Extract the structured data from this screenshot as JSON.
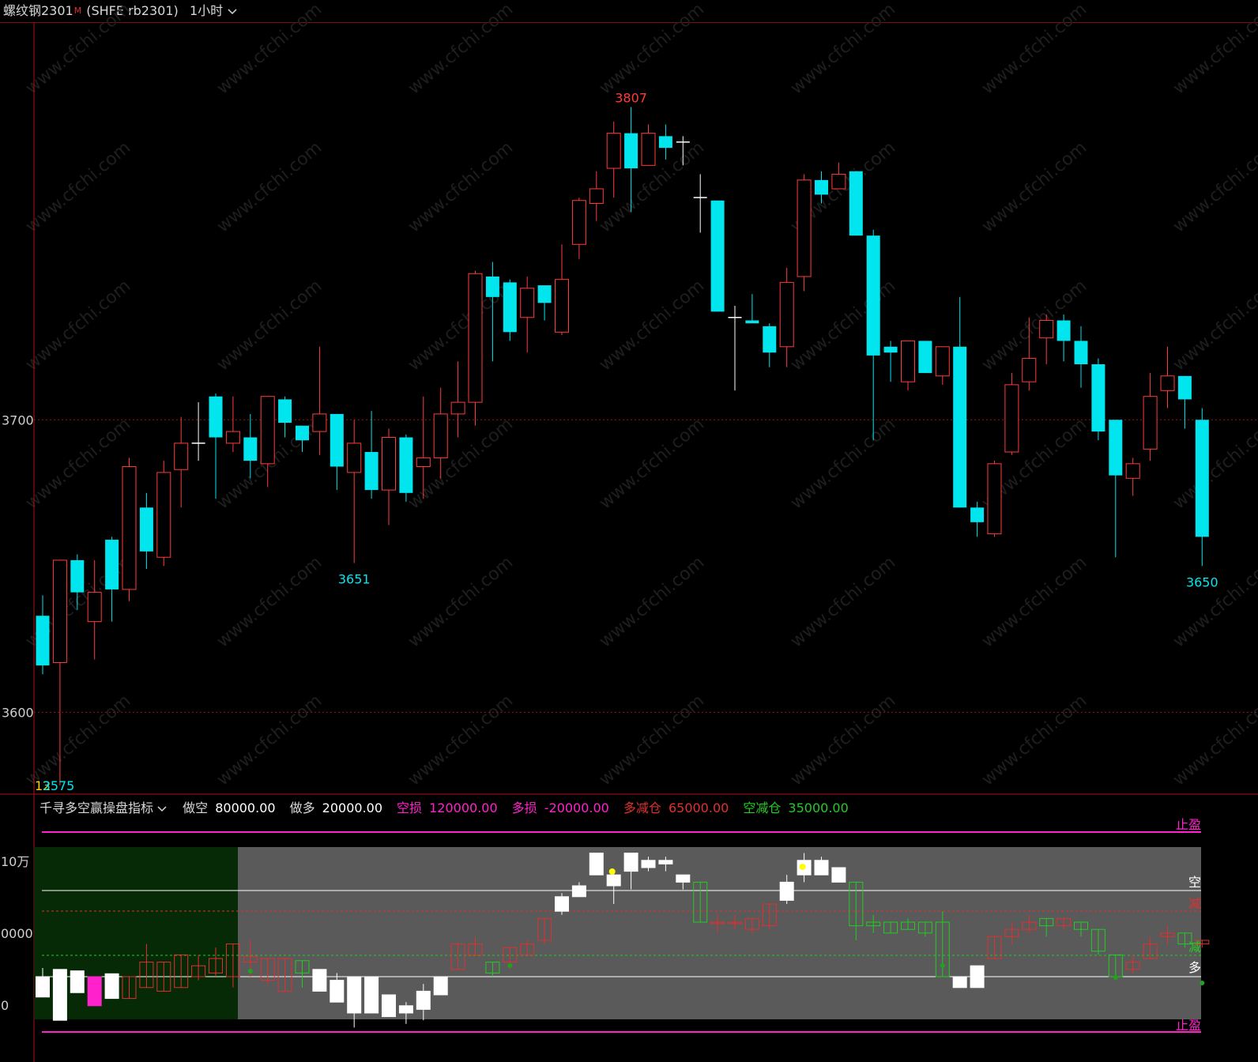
{
  "header": {
    "title": "螺纹钢2301",
    "superscript": "M",
    "code": "(SHFE rb2301)",
    "period": "1小时",
    "period_icon": "chevron-down-icon"
  },
  "indicator": {
    "name": "千寻多空赢操盘指标",
    "name_icon": "chevron-down-icon",
    "params": [
      {
        "label": "做空",
        "value": "80000.00",
        "label_color": "#d8d8d8",
        "value_color": "#ffffff"
      },
      {
        "label": "做多",
        "value": "20000.00",
        "label_color": "#d8d8d8",
        "value_color": "#ffffff"
      },
      {
        "label": "空损",
        "value": "120000.00",
        "label_color": "#ff22cc",
        "value_color": "#ff22cc"
      },
      {
        "label": "多损",
        "value": "-20000.00",
        "label_color": "#ff22cc",
        "value_color": "#ff22cc"
      },
      {
        "label": "多减仓",
        "value": "65000.00",
        "label_color": "#e03030",
        "value_color": "#e03030"
      },
      {
        "label": "空减仓",
        "value": "35000.00",
        "label_color": "#22cc22",
        "value_color": "#22cc22"
      }
    ],
    "y_labels": [
      "10万",
      "0000",
      "0"
    ],
    "right_labels": {
      "stop_top": "止盈",
      "stop_bottom": "止盈",
      "short": "空",
      "reduce_short": "减",
      "reduce_long": "减",
      "long": "多"
    },
    "bars": [
      {
        "open": 0,
        "close": -28,
        "high": 12,
        "low": -28
      },
      {
        "open": 10,
        "close": -60,
        "high": 10,
        "low": -60
      },
      {
        "open": 8,
        "close": -22,
        "high": 8,
        "low": -22
      },
      {
        "open": 0,
        "close": -40,
        "high": 0,
        "low": -40
      },
      {
        "open": 4,
        "close": -30,
        "high": 4,
        "low": -30
      },
      {
        "open": -30,
        "close": 0,
        "high": 0,
        "low": -30
      },
      {
        "open": -15,
        "close": 20,
        "high": 45,
        "low": -15
      },
      {
        "open": -20,
        "close": 20,
        "high": 20,
        "low": -20
      },
      {
        "open": -15,
        "close": 30,
        "high": 30,
        "low": -15
      },
      {
        "open": 0,
        "close": 15,
        "high": 30,
        "low": -5
      },
      {
        "open": 5,
        "close": 25,
        "high": 40,
        "low": 0
      },
      {
        "open": 0,
        "close": 45,
        "high": 45,
        "low": -15
      },
      {
        "open": 20,
        "close": 28,
        "high": 50,
        "low": 0
      },
      {
        "open": -5,
        "close": 25,
        "high": 25,
        "low": -10
      },
      {
        "open": -20,
        "close": 25,
        "high": 25,
        "low": -20
      },
      {
        "open": 22,
        "close": 5,
        "high": 22,
        "low": -15
      },
      {
        "open": 10,
        "close": -20,
        "high": 10,
        "low": -20
      },
      {
        "open": -5,
        "close": -35,
        "high": 5,
        "low": -35
      },
      {
        "open": 0,
        "close": -50,
        "high": 0,
        "low": -70
      },
      {
        "open": 0,
        "close": -50,
        "high": 0,
        "low": -50
      },
      {
        "open": -25,
        "close": -55,
        "high": -25,
        "low": -55
      },
      {
        "open": -40,
        "close": -50,
        "high": -35,
        "low": -65
      },
      {
        "open": -45,
        "close": -20,
        "high": -10,
        "low": -60
      },
      {
        "open": 0,
        "close": -25,
        "high": 0,
        "low": -25
      },
      {
        "open": 10,
        "close": 45,
        "high": 45,
        "low": 10
      },
      {
        "open": 30,
        "close": 45,
        "high": 55,
        "low": 30
      },
      {
        "open": 20,
        "close": 5,
        "high": 20,
        "low": 0
      },
      {
        "open": 20,
        "close": 40,
        "high": 40,
        "low": 10
      },
      {
        "open": 30,
        "close": 45,
        "high": 50,
        "low": 30
      },
      {
        "open": 50,
        "close": 80,
        "high": 80,
        "low": 45
      },
      {
        "open": 90,
        "close": 110,
        "high": 115,
        "low": 85
      },
      {
        "open": 110,
        "close": 125,
        "high": 130,
        "low": 110
      },
      {
        "open": 140,
        "close": 170,
        "high": 170,
        "low": 140
      },
      {
        "open": 125,
        "close": 140,
        "high": 145,
        "low": 100
      },
      {
        "open": 145,
        "close": 170,
        "high": 170,
        "low": 120
      },
      {
        "open": 150,
        "close": 160,
        "high": 165,
        "low": 145
      },
      {
        "open": 155,
        "close": 160,
        "high": 165,
        "low": 145
      },
      {
        "open": 140,
        "close": 130,
        "high": 140,
        "low": 120
      },
      {
        "open": 130,
        "close": 75,
        "high": 130,
        "low": 75
      },
      {
        "open": 75,
        "close": 75,
        "high": 85,
        "low": 60
      },
      {
        "open": 75,
        "close": 75,
        "high": 85,
        "low": 65
      },
      {
        "open": 65,
        "close": 80,
        "high": 80,
        "low": 60
      },
      {
        "open": 70,
        "close": 100,
        "high": 100,
        "low": 65
      },
      {
        "open": 105,
        "close": 130,
        "high": 140,
        "low": 100
      },
      {
        "open": 140,
        "close": 160,
        "high": 170,
        "low": 130
      },
      {
        "open": 140,
        "close": 160,
        "high": 165,
        "low": 140
      },
      {
        "open": 150,
        "close": 130,
        "high": 150,
        "low": 130
      },
      {
        "open": 130,
        "close": 70,
        "high": 130,
        "low": 50
      },
      {
        "open": 75,
        "close": 70,
        "high": 85,
        "low": 60
      },
      {
        "open": 75,
        "close": 60,
        "high": 75,
        "low": 60
      },
      {
        "open": 75,
        "close": 65,
        "high": 80,
        "low": 65
      },
      {
        "open": 75,
        "close": 60,
        "high": 75,
        "low": 55
      },
      {
        "open": 75,
        "close": 0,
        "high": 90,
        "low": 0
      },
      {
        "open": 0,
        "close": -15,
        "high": 0,
        "low": -15
      },
      {
        "open": 15,
        "close": -15,
        "high": 15,
        "low": -15
      },
      {
        "open": 25,
        "close": 55,
        "high": 55,
        "low": 25
      },
      {
        "open": 55,
        "close": 65,
        "high": 75,
        "low": 45
      },
      {
        "open": 65,
        "close": 75,
        "high": 85,
        "low": 60
      },
      {
        "open": 80,
        "close": 70,
        "high": 80,
        "low": 55
      },
      {
        "open": 70,
        "close": 80,
        "high": 80,
        "low": 65
      },
      {
        "open": 75,
        "close": 65,
        "high": 75,
        "low": 55
      },
      {
        "open": 65,
        "close": 35,
        "high": 65,
        "low": 30
      },
      {
        "open": 30,
        "close": 0,
        "high": 30,
        "low": 0
      },
      {
        "open": 10,
        "close": 20,
        "high": 30,
        "low": 5
      },
      {
        "open": 25,
        "close": 45,
        "high": 55,
        "low": 25
      },
      {
        "open": 55,
        "close": 60,
        "high": 70,
        "low": 45
      },
      {
        "open": 60,
        "close": 45,
        "high": 60,
        "low": 40
      },
      {
        "open": 45,
        "close": 50,
        "high": 50,
        "low": 40
      }
    ]
  },
  "chart_data": [
    {
      "type": "candlestick",
      "title": "螺纹钢2301 (SHFE rb2301) 1小时",
      "y_ticks": [
        3600,
        3700
      ],
      "ylim": [
        3572,
        3836
      ],
      "annotations": [
        {
          "text": "3807",
          "index": 34,
          "at": "high"
        },
        {
          "text": "3651",
          "index": 18,
          "at": "low"
        },
        {
          "text": "3650",
          "index": 67,
          "at": "low"
        },
        {
          "text": "12",
          "index": 1,
          "at": "bottom-left"
        },
        {
          "text": "3575",
          "index": 1,
          "at": "low"
        }
      ],
      "colors": {
        "up": "#ff3b3b",
        "down": "#00e5ee",
        "doji": "#ffffff",
        "grid": "#8b1a1a",
        "axis": "#b01010"
      },
      "candles": [
        {
          "o": 3633,
          "c": 3616,
          "h": 3640,
          "l": 3613
        },
        {
          "o": 3617,
          "c": 3652,
          "h": 3652,
          "l": 3575
        },
        {
          "o": 3652,
          "c": 3641,
          "h": 3654,
          "l": 3635
        },
        {
          "o": 3631,
          "c": 3641,
          "h": 3652,
          "l": 3618
        },
        {
          "o": 3659,
          "c": 3642,
          "h": 3660,
          "l": 3631
        },
        {
          "o": 3642,
          "c": 3684,
          "h": 3687,
          "l": 3638
        },
        {
          "o": 3670,
          "c": 3655,
          "h": 3675,
          "l": 3649
        },
        {
          "o": 3653,
          "c": 3682,
          "h": 3686,
          "l": 3650
        },
        {
          "o": 3683,
          "c": 3692,
          "h": 3701,
          "l": 3670
        },
        {
          "o": 3692,
          "c": 3692,
          "h": 3706,
          "l": 3686
        },
        {
          "o": 3708,
          "c": 3694,
          "h": 3709,
          "l": 3673
        },
        {
          "o": 3692,
          "c": 3696,
          "h": 3708,
          "l": 3689
        },
        {
          "o": 3694,
          "c": 3686,
          "h": 3702,
          "l": 3680
        },
        {
          "o": 3685,
          "c": 3708,
          "h": 3708,
          "l": 3677
        },
        {
          "o": 3707,
          "c": 3699,
          "h": 3708,
          "l": 3694
        },
        {
          "o": 3698,
          "c": 3693,
          "h": 3698,
          "l": 3689
        },
        {
          "o": 3696,
          "c": 3702,
          "h": 3725,
          "l": 3688
        },
        {
          "o": 3702,
          "c": 3684,
          "h": 3702,
          "l": 3676
        },
        {
          "o": 3682,
          "c": 3692,
          "h": 3700,
          "l": 3651
        },
        {
          "o": 3689,
          "c": 3676,
          "h": 3703,
          "l": 3673
        },
        {
          "o": 3676,
          "c": 3694,
          "h": 3697,
          "l": 3664
        },
        {
          "o": 3694,
          "c": 3675,
          "h": 3695,
          "l": 3672
        },
        {
          "o": 3684,
          "c": 3687,
          "h": 3708,
          "l": 3673
        },
        {
          "o": 3687,
          "c": 3702,
          "h": 3711,
          "l": 3680
        },
        {
          "o": 3702,
          "c": 3706,
          "h": 3720,
          "l": 3694
        },
        {
          "o": 3706,
          "c": 3750,
          "h": 3751,
          "l": 3698
        },
        {
          "o": 3749,
          "c": 3742,
          "h": 3754,
          "l": 3720
        },
        {
          "o": 3747,
          "c": 3730,
          "h": 3748,
          "l": 3727
        },
        {
          "o": 3735,
          "c": 3745,
          "h": 3749,
          "l": 3723
        },
        {
          "o": 3746,
          "c": 3740,
          "h": 3746,
          "l": 3734
        },
        {
          "o": 3730,
          "c": 3748,
          "h": 3760,
          "l": 3729
        },
        {
          "o": 3760,
          "c": 3775,
          "h": 3776,
          "l": 3755
        },
        {
          "o": 3774,
          "c": 3779,
          "h": 3785,
          "l": 3768
        },
        {
          "o": 3786,
          "c": 3798,
          "h": 3802,
          "l": 3776
        },
        {
          "o": 3798,
          "c": 3786,
          "h": 3807,
          "l": 3771
        },
        {
          "o": 3787,
          "c": 3798,
          "h": 3801,
          "l": 3787
        },
        {
          "o": 3797,
          "c": 3793,
          "h": 3801,
          "l": 3789
        },
        {
          "o": 3795,
          "c": 3795,
          "h": 3797,
          "l": 3787
        },
        {
          "o": 3776,
          "c": 3776,
          "h": 3784,
          "l": 3764
        },
        {
          "o": 3775,
          "c": 3737,
          "h": 3775,
          "l": 3737
        },
        {
          "o": 3735,
          "c": 3735,
          "h": 3739,
          "l": 3710
        },
        {
          "o": 3734,
          "c": 3733,
          "h": 3743,
          "l": 3733
        },
        {
          "o": 3732,
          "c": 3723,
          "h": 3733,
          "l": 3718
        },
        {
          "o": 3725,
          "c": 3747,
          "h": 3752,
          "l": 3718
        },
        {
          "o": 3749,
          "c": 3782,
          "h": 3784,
          "l": 3744
        },
        {
          "o": 3782,
          "c": 3777,
          "h": 3785,
          "l": 3774
        },
        {
          "o": 3779,
          "c": 3784,
          "h": 3788,
          "l": 3779
        },
        {
          "o": 3785,
          "c": 3763,
          "h": 3785,
          "l": 3763
        },
        {
          "o": 3763,
          "c": 3722,
          "h": 3765,
          "l": 3693
        },
        {
          "o": 3725,
          "c": 3723,
          "h": 3727,
          "l": 3713
        },
        {
          "o": 3713,
          "c": 3727,
          "h": 3727,
          "l": 3710
        },
        {
          "o": 3727,
          "c": 3716,
          "h": 3727,
          "l": 3716
        },
        {
          "o": 3715,
          "c": 3725,
          "h": 3725,
          "l": 3712
        },
        {
          "o": 3725,
          "c": 3670,
          "h": 3742,
          "l": 3670
        },
        {
          "o": 3670,
          "c": 3665,
          "h": 3672,
          "l": 3660
        },
        {
          "o": 3661,
          "c": 3685,
          "h": 3686,
          "l": 3660
        },
        {
          "o": 3689,
          "c": 3712,
          "h": 3716,
          "l": 3688
        },
        {
          "o": 3713,
          "c": 3721,
          "h": 3735,
          "l": 3710
        },
        {
          "o": 3728,
          "c": 3734,
          "h": 3736,
          "l": 3719
        },
        {
          "o": 3734,
          "c": 3727,
          "h": 3736,
          "l": 3720
        },
        {
          "o": 3727,
          "c": 3719,
          "h": 3732,
          "l": 3711
        },
        {
          "o": 3719,
          "c": 3696,
          "h": 3721,
          "l": 3693
        },
        {
          "o": 3700,
          "c": 3681,
          "h": 3700,
          "l": 3653
        },
        {
          "o": 3680,
          "c": 3685,
          "h": 3687,
          "l": 3674
        },
        {
          "o": 3690,
          "c": 3708,
          "h": 3716,
          "l": 3686
        },
        {
          "o": 3710,
          "c": 3715,
          "h": 3725,
          "l": 3704
        },
        {
          "o": 3715,
          "c": 3707,
          "h": 3715,
          "l": 3697
        },
        {
          "o": 3700,
          "c": 3660,
          "h": 3704,
          "l": 3650
        }
      ]
    }
  ]
}
